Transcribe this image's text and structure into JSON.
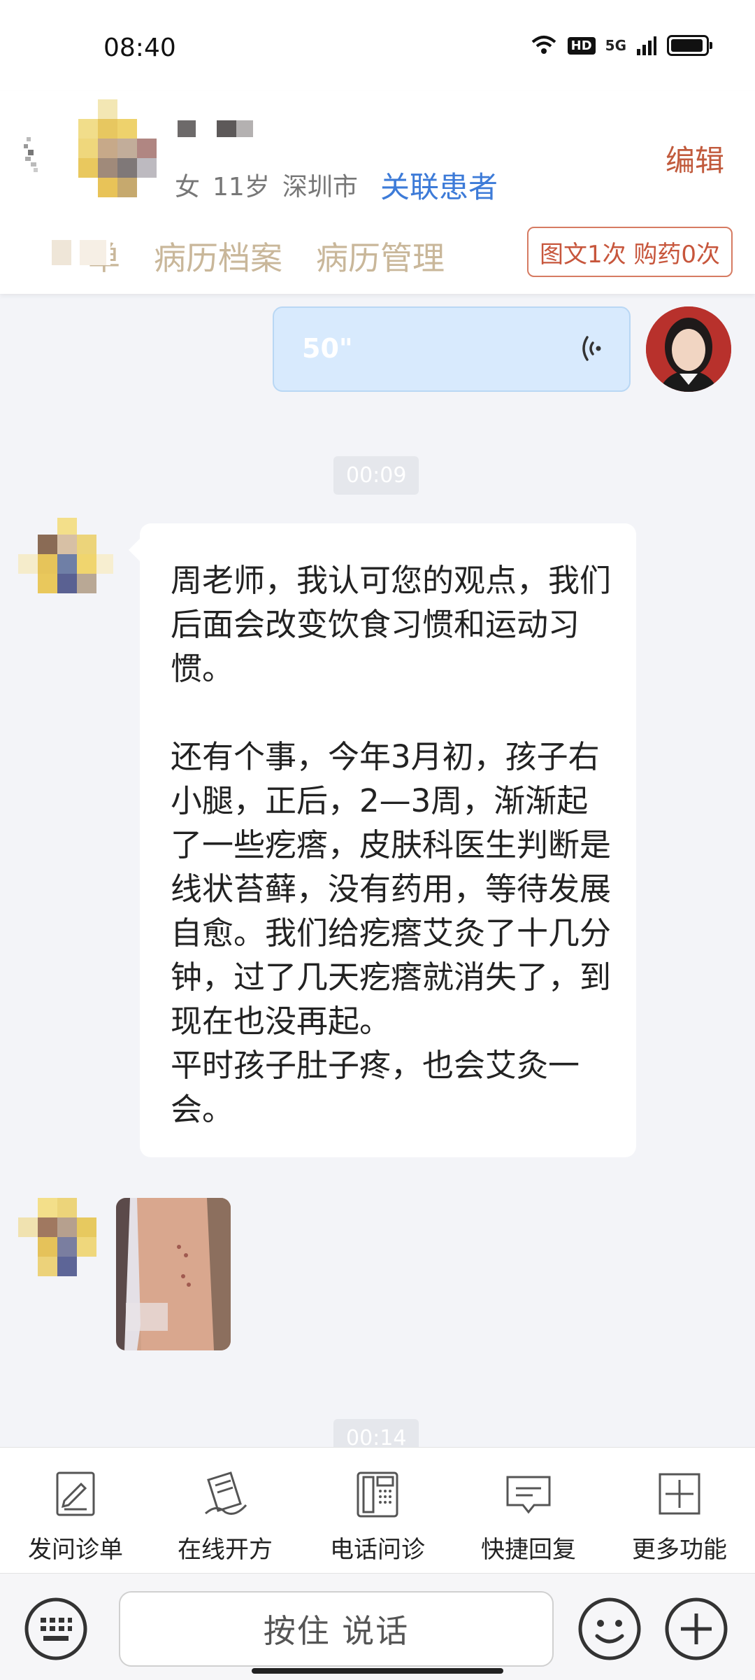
{
  "status_bar": {
    "time": "08:40",
    "hd": "HD",
    "network": "5G"
  },
  "header": {
    "gender": "女",
    "age": "11岁",
    "city": "深圳市",
    "link_patient": "关联患者",
    "edit": "编辑",
    "tabs": [
      "单",
      "病历档案",
      "病历管理"
    ],
    "count_badge": "图文1次 购药0次"
  },
  "chat": {
    "voice_duration": "50\"",
    "time_1": "00:09",
    "message_text": "周老师，我认可您的观点，我们后面会改变饮食习惯和运动习惯。\n\n还有个事，今年3月初，孩子右小腿，正后，2—3周，渐渐起了一些疙瘩，皮肤科医生判断是线状苔藓，没有药用，等待发展自愈。我们给疙瘩艾灸了十几分钟，过了几天疙瘩就消失了，到现在也没再起。\n平时孩子肚子疼，也会艾灸一会。",
    "time_2": "00:14"
  },
  "toolbar": {
    "items": [
      {
        "label": "发问诊单",
        "icon": "form-edit-icon"
      },
      {
        "label": "在线开方",
        "icon": "prescription-sign-icon"
      },
      {
        "label": "电话问诊",
        "icon": "phone-icon"
      },
      {
        "label": "快捷回复",
        "icon": "quick-reply-icon"
      },
      {
        "label": "更多功能",
        "icon": "plus-square-icon"
      }
    ]
  },
  "input_bar": {
    "hold_to_talk": "按住 说话"
  },
  "colors": {
    "link": "#3d7bd8",
    "edit": "#c15a3c",
    "tab": "#c9b79a",
    "voice_bubble": "#d8eafd"
  }
}
